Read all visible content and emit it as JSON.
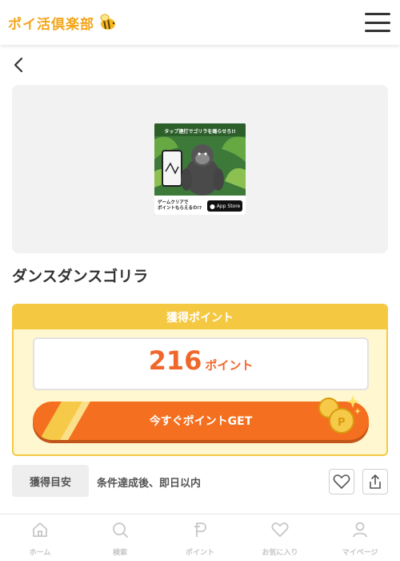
{
  "header": {
    "logo_text": "ポイ活倶楽部",
    "menu_icon": "hamburger-menu-icon"
  },
  "nav": {
    "back_icon": "chevron-left-icon"
  },
  "offer": {
    "banner": {
      "caption": "タップ連打でゴリラを踊らせろ!!",
      "bottom_text_1": "ゲームクリアで",
      "bottom_text_2": "ポイントもらえるの!?",
      "store_badge": "App Store"
    },
    "title": "ダンスダンスゴリラ"
  },
  "points": {
    "header": "獲得ポイント",
    "value": "216",
    "unit": "ポイント",
    "cta_label": "今すぐポイントGET"
  },
  "estimate": {
    "label": "獲得目安",
    "value": "条件達成後、即日以内"
  },
  "bottom_nav": [
    {
      "label": "ホーム",
      "icon": "home-icon"
    },
    {
      "label": "検索",
      "icon": "search-icon"
    },
    {
      "label": "ポイント",
      "icon": "point-icon"
    },
    {
      "label": "お気に入り",
      "icon": "heart-icon"
    },
    {
      "label": "マイページ",
      "icon": "user-icon"
    }
  ],
  "colors": {
    "accent": "#f46f1f",
    "gold": "#f5c842",
    "points_text": "#f0672b",
    "nav_inactive": "#c6c6c6"
  }
}
